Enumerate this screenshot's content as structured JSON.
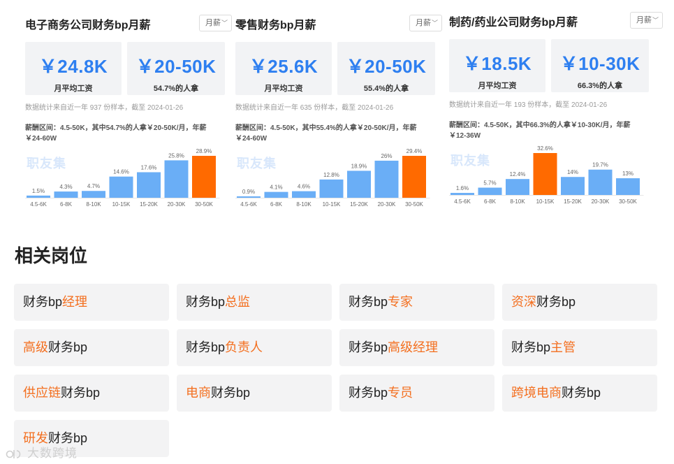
{
  "cards": [
    {
      "title": "电子商务公司财务bp月薪",
      "period": "月薪",
      "avg_value": "￥24.8K",
      "avg_label": "月平均工资",
      "range_value": "￥20-50K",
      "range_label": "54.7%的人拿",
      "note": "数据统计来自近一年 937 份样本，截至 2024-01-26",
      "desc": "薪酬区间：4.5-50K，其中54.7%的人拿￥20-50K/月，年薪￥24-60W",
      "brand": "职友集",
      "chart_data": {
        "type": "bar",
        "categories": [
          "4.5-6K",
          "6-8K",
          "8-10K",
          "10-15K",
          "15-20K",
          "20-30K",
          "30-50K"
        ],
        "values": [
          1.5,
          4.3,
          4.7,
          14.6,
          17.6,
          25.8,
          28.9
        ],
        "labels": [
          "1.5%",
          "4.3%",
          "4.7%",
          "14.6%",
          "17.6%",
          "25.8%",
          "28.9%"
        ],
        "highlight_index": 6,
        "colors": {
          "normal": "#6aaef6",
          "highlight": "#ff6a00"
        }
      }
    },
    {
      "title": "零售财务bp月薪",
      "period": "月薪",
      "avg_value": "￥25.6K",
      "avg_label": "月平均工资",
      "range_value": "￥20-50K",
      "range_label": "55.4%的人拿",
      "note": "数据统计来自近一年 635 份样本，截至 2024-01-26",
      "desc": "薪酬区间：4.5-50K，其中55.4%的人拿￥20-50K/月，年薪￥24-60W",
      "brand": "职友集",
      "chart_data": {
        "type": "bar",
        "categories": [
          "4.5-6K",
          "6-8K",
          "8-10K",
          "10-15K",
          "15-20K",
          "20-30K",
          "30-50K"
        ],
        "values": [
          0.9,
          4.1,
          4.6,
          12.8,
          18.9,
          26,
          29.4
        ],
        "labels": [
          "0.9%",
          "4.1%",
          "4.6%",
          "12.8%",
          "18.9%",
          "26%",
          "29.4%"
        ],
        "highlight_index": 6,
        "colors": {
          "normal": "#6aaef6",
          "highlight": "#ff6a00"
        }
      }
    },
    {
      "title": "制药/药业公司财务bp月薪",
      "period": "月薪",
      "avg_value": "￥18.5K",
      "avg_label": "月平均工资",
      "range_value": "￥10-30K",
      "range_label": "66.3%的人拿",
      "note": "数据统计来自近一年 193 份样本，截至 2024-01-26",
      "desc": "薪酬区间：4.5-50K，其中66.3%的人拿￥10-30K/月，年薪￥12-36W",
      "brand": "职友集",
      "chart_data": {
        "type": "bar",
        "categories": [
          "4.5-6K",
          "6-8K",
          "8-10K",
          "10-15K",
          "15-20K",
          "20-30K",
          "30-50K"
        ],
        "values": [
          1.6,
          5.7,
          12.4,
          32.6,
          14,
          19.7,
          13
        ],
        "labels": [
          "1.6%",
          "5.7%",
          "12.4%",
          "32.6%",
          "14%",
          "19.7%",
          "13%"
        ],
        "highlight_index": 3,
        "colors": {
          "normal": "#6aaef6",
          "highlight": "#ff6a00"
        }
      }
    }
  ],
  "related": {
    "title": "相关岗位",
    "items": [
      {
        "parts": [
          {
            "t": "财务bp",
            "hl": false
          },
          {
            "t": "经理",
            "hl": true
          }
        ]
      },
      {
        "parts": [
          {
            "t": "财务bp",
            "hl": false
          },
          {
            "t": "总监",
            "hl": true
          }
        ]
      },
      {
        "parts": [
          {
            "t": "财务bp",
            "hl": false
          },
          {
            "t": "专家",
            "hl": true
          }
        ]
      },
      {
        "parts": [
          {
            "t": "资深",
            "hl": true
          },
          {
            "t": "财务bp",
            "hl": false
          }
        ]
      },
      {
        "parts": [
          {
            "t": "高级",
            "hl": true
          },
          {
            "t": "财务bp",
            "hl": false
          }
        ]
      },
      {
        "parts": [
          {
            "t": "财务bp",
            "hl": false
          },
          {
            "t": "负责人",
            "hl": true
          }
        ]
      },
      {
        "parts": [
          {
            "t": "财务bp",
            "hl": false
          },
          {
            "t": "高级经理",
            "hl": true
          }
        ]
      },
      {
        "parts": [
          {
            "t": "财务bp",
            "hl": false
          },
          {
            "t": "主管",
            "hl": true
          }
        ]
      },
      {
        "parts": [
          {
            "t": "供应链",
            "hl": true
          },
          {
            "t": "财务bp",
            "hl": false
          }
        ]
      },
      {
        "parts": [
          {
            "t": "电商",
            "hl": true
          },
          {
            "t": "财务bp",
            "hl": false
          }
        ]
      },
      {
        "parts": [
          {
            "t": "财务bp",
            "hl": false
          },
          {
            "t": "专员",
            "hl": true
          }
        ]
      },
      {
        "parts": [
          {
            "t": "跨境电商",
            "hl": true
          },
          {
            "t": "财务bp",
            "hl": false
          }
        ]
      },
      {
        "parts": [
          {
            "t": "研发",
            "hl": true
          },
          {
            "t": "财务bp",
            "hl": false
          }
        ]
      }
    ]
  },
  "footer": {
    "watermark": "大数跨境"
  },
  "colors": {
    "accent_blue": "#2e7ff0",
    "accent_orange": "#f36f1f"
  }
}
